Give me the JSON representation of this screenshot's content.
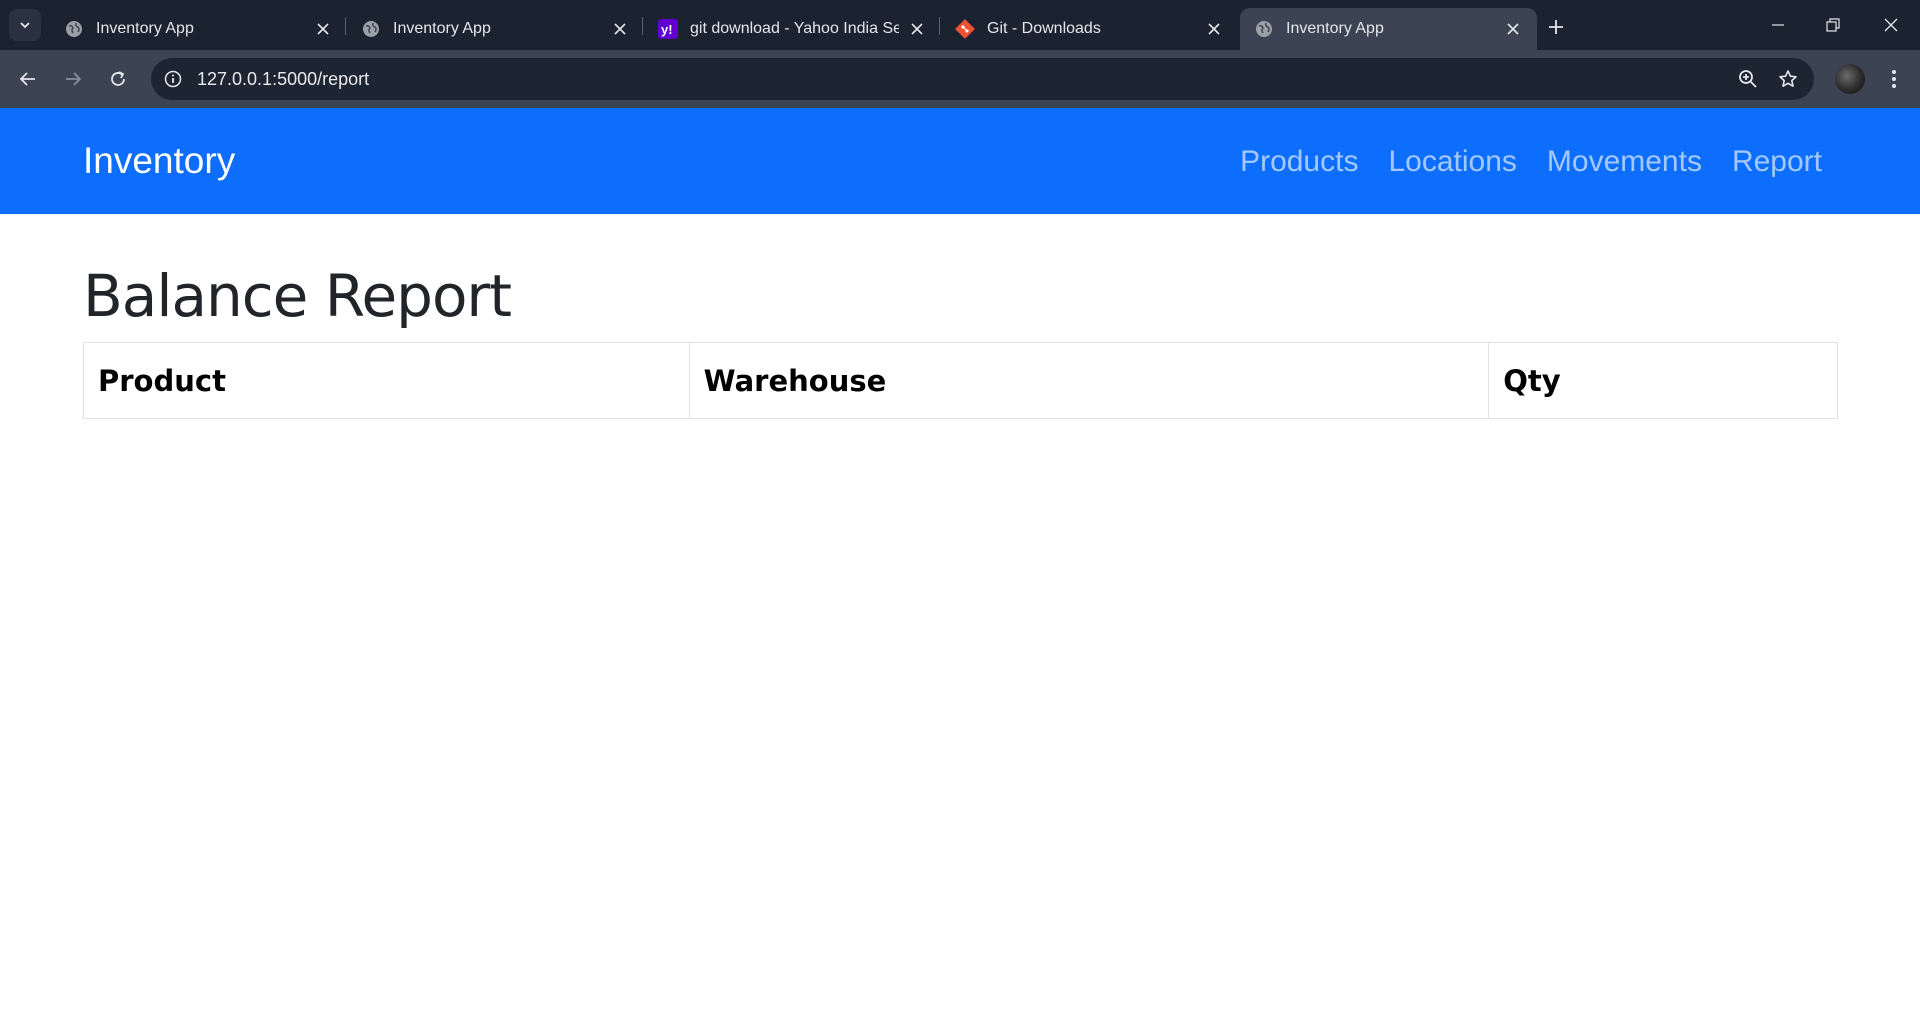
{
  "browser": {
    "tabs": [
      {
        "title": "Inventory App",
        "favicon": "globe-icon",
        "active": false
      },
      {
        "title": "Inventory App",
        "favicon": "globe-icon",
        "active": false
      },
      {
        "title": "git download - Yahoo India Sea",
        "favicon": "yahoo-icon",
        "active": false
      },
      {
        "title": "Git - Downloads",
        "favicon": "git-icon",
        "active": false
      },
      {
        "title": "Inventory App",
        "favicon": "globe-icon",
        "active": true
      }
    ],
    "url": "127.0.0.1:5000/report",
    "colors": {
      "tabstrip": "#1b2230",
      "toolbar": "#3c4453",
      "omnibox": "#1e2532"
    }
  },
  "navbar": {
    "brand": "Inventory",
    "links": [
      "Products",
      "Locations",
      "Movements",
      "Report"
    ],
    "color": "#0d6efd"
  },
  "main": {
    "title": "Balance Report",
    "table": {
      "columns": [
        "Product",
        "Warehouse",
        "Qty"
      ],
      "rows": []
    }
  }
}
